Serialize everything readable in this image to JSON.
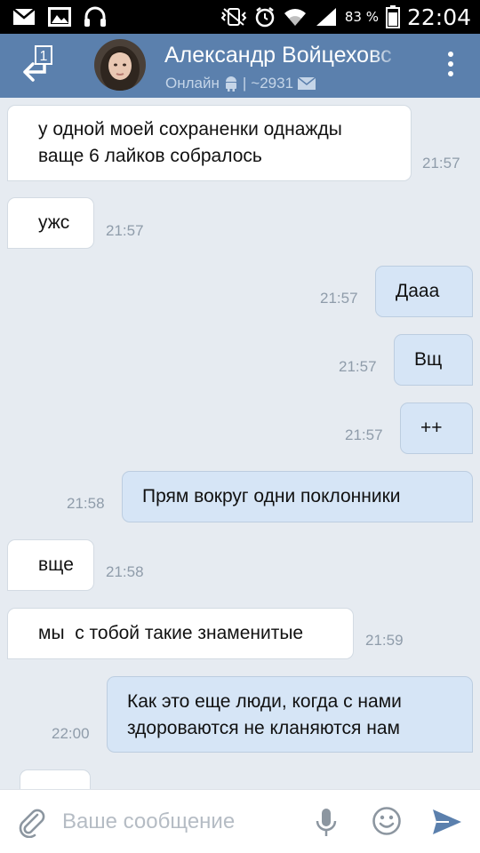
{
  "status_bar": {
    "battery_percent": "83 %",
    "time": "22:04"
  },
  "header": {
    "back_badge": "1",
    "contact_name": "Александр Войцеховс",
    "status_online": "Онлайн",
    "separator": "|",
    "message_count": "~2931"
  },
  "messages": [
    {
      "direction": "in",
      "lines": "у одной моей сохраненки однажды\nваще 6 лайков собралось",
      "time": "21:57"
    },
    {
      "direction": "in",
      "lines": "ужс",
      "time": "21:57"
    },
    {
      "direction": "out",
      "lines": "Дааа",
      "time": "21:57"
    },
    {
      "direction": "out",
      "lines": "Вщ",
      "time": "21:57"
    },
    {
      "direction": "out",
      "lines": "++",
      "time": "21:57"
    },
    {
      "direction": "out",
      "lines": "Прям вокруг одни поклонники",
      "time": "21:58"
    },
    {
      "direction": "in",
      "lines": "вще",
      "time": "21:58"
    },
    {
      "direction": "in",
      "lines": "мы  с тобой такие знаменитые",
      "time": "21:59"
    },
    {
      "direction": "out",
      "lines": "Как это еще люди, когда с нами\nздороваются не кланяются нам",
      "time": "22:00"
    },
    {
      "direction": "in",
      "lines": "",
      "time": ""
    }
  ],
  "input": {
    "placeholder": "Ваше сообщение"
  },
  "colors": {
    "header": "#5b80ad",
    "background": "#e6ebf1",
    "outgoing_bubble": "#d6e5f6",
    "incoming_bubble": "#ffffff",
    "send_icon": "#5b80ad"
  },
  "icons": [
    "mail-icon",
    "image-icon",
    "headphones-icon",
    "vibrate-icon",
    "alarm-icon",
    "wifi-icon",
    "signal-icon",
    "battery-icon",
    "back-arrow-icon",
    "android-icon",
    "envelope-icon",
    "more-icon",
    "attach-icon",
    "mic-icon",
    "smile-icon",
    "send-icon"
  ]
}
